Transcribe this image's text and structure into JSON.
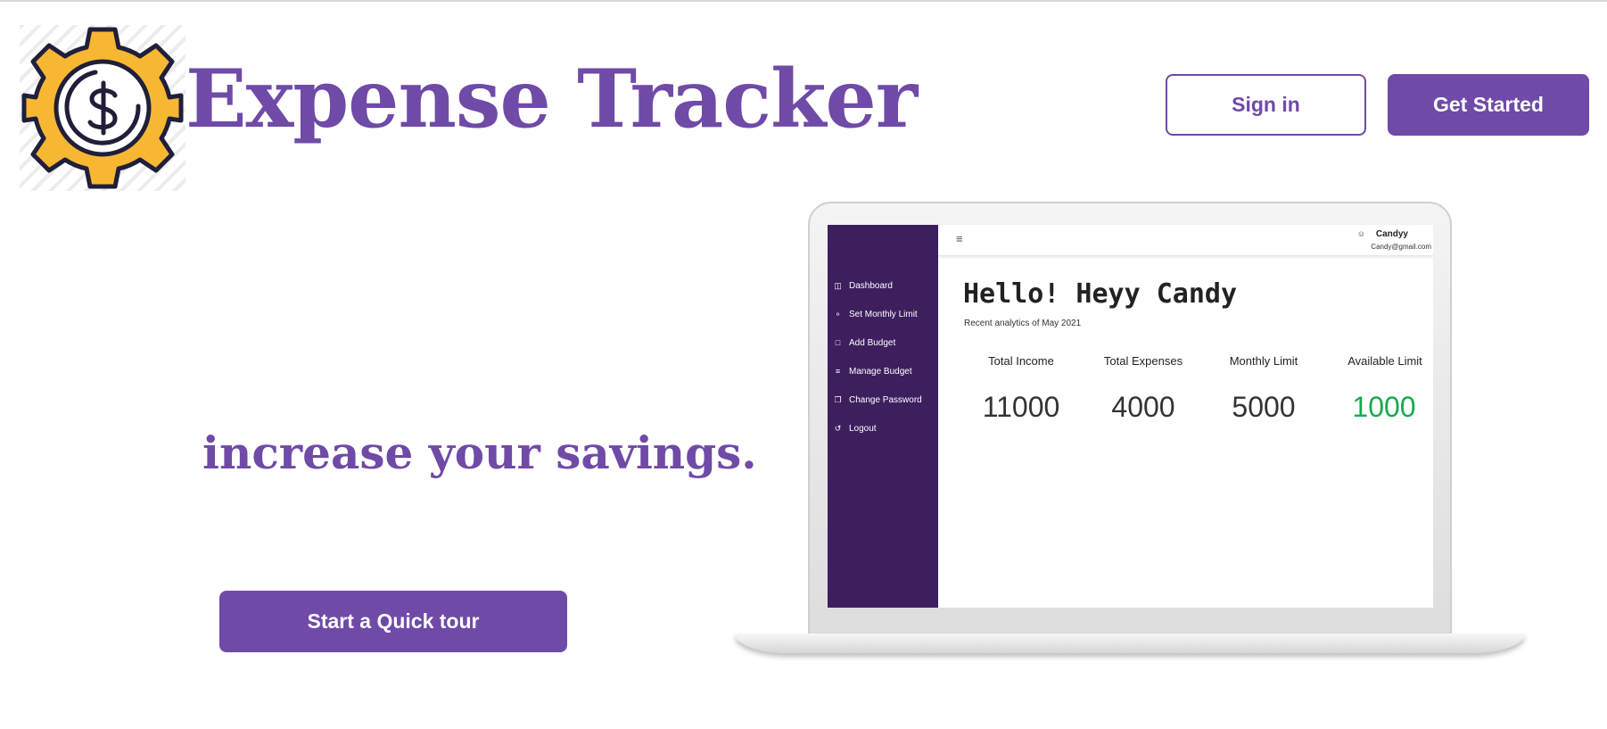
{
  "header": {
    "logo_icon": "gear-dollar-icon",
    "title": "Expense Tracker",
    "signin_label": "Sign in",
    "get_started_label": "Get Started"
  },
  "hero": {
    "tagline": "increase your savings.",
    "tour_label": "Start a Quick tour"
  },
  "preview": {
    "sidebar": [
      {
        "icon": "dashboard-icon",
        "label": "Dashboard"
      },
      {
        "icon": "bell-icon",
        "label": "Set Monthly Limit"
      },
      {
        "icon": "wallet-icon",
        "label": "Add Budget"
      },
      {
        "icon": "list-icon",
        "label": "Manage Budget"
      },
      {
        "icon": "copy-icon",
        "label": "Change Password"
      },
      {
        "icon": "logout-icon",
        "label": "Logout"
      }
    ],
    "user": {
      "name": "Candyy",
      "email": "Candy@gmail.com"
    },
    "greeting": "Hello! Heyy Candy",
    "subtitle": "Recent analytics of May 2021",
    "stats": [
      {
        "label": "Total Income",
        "value": "11000"
      },
      {
        "label": "Total Expenses",
        "value": "4000"
      },
      {
        "label": "Monthly Limit",
        "value": "5000"
      },
      {
        "label": "Available Limit",
        "value": "1000"
      }
    ]
  },
  "colors": {
    "brand": "#6f4aa7",
    "sidebar": "#3d1f5e",
    "gear": "#f7b733",
    "available": "#1aa84f"
  }
}
